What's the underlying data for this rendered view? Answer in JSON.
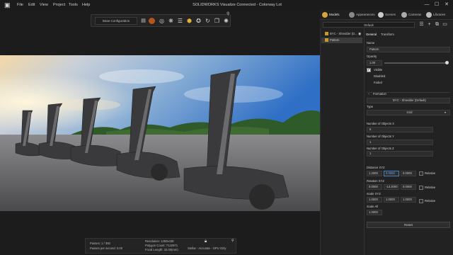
{
  "app": {
    "title": "SOLIDWORKS Visualize Connected - Colorway Lot",
    "icon": "sw-logo-icon"
  },
  "menu": [
    "File",
    "Edit",
    "View",
    "Project",
    "Tools",
    "Help"
  ],
  "window_controls": [
    "—",
    "☐",
    "✕"
  ],
  "toolbar": {
    "config_label": "Base Configuration"
  },
  "stats": {
    "passes": "Passes: 1 / 350",
    "pps": "Passes per second: 0.00",
    "resolution": "Resolution: 1250x438",
    "polygons": "Polygon Count: 7122971",
    "focal": "Focal Length: 32.00(mm)",
    "render_mode": "Stellar - Accurate - GPU Only"
  },
  "tabs": [
    "Models",
    "Appearances",
    "Scenes",
    "Cameras",
    "Libraries"
  ],
  "scene_selector": "Default",
  "tree": [
    {
      "label": "BYC - Shredder (D..."
    },
    {
      "label": "Pattern"
    }
  ],
  "props": {
    "tabs": [
      "General",
      "Transform"
    ],
    "name_label": "Name",
    "name_value": "Pattern",
    "opacity_label": "Opacity",
    "opacity_value": "1.00",
    "opacity_level": 1.0,
    "visible": "Visible",
    "disabled": "Disabled",
    "faded": "Faded",
    "formation_header": "Formation",
    "formation_value": "BYC - Shredder (Default)",
    "type_label": "Type",
    "type_value": "Grid",
    "nx_label": "Number of Objects X",
    "nx_value": "5",
    "ny_label": "Number of Objects Y",
    "ny_value": "1",
    "nz_label": "Number of Objects Z",
    "nz_value": "1",
    "dist_label": "Distance XYZ",
    "dist": [
      "1.2000",
      "0.0000",
      "0.0000"
    ],
    "rot_label": "Rotation XYZ",
    "rot": [
      "0.0000",
      "-14.2000",
      "0.0000"
    ],
    "scale_label": "Scale XYZ",
    "scale": [
      "1.0000",
      "1.0000",
      "1.0000"
    ],
    "scale_all_label": "Scale All",
    "scale_all": "1.0000",
    "relative": "Relative",
    "reset": "Reset"
  }
}
